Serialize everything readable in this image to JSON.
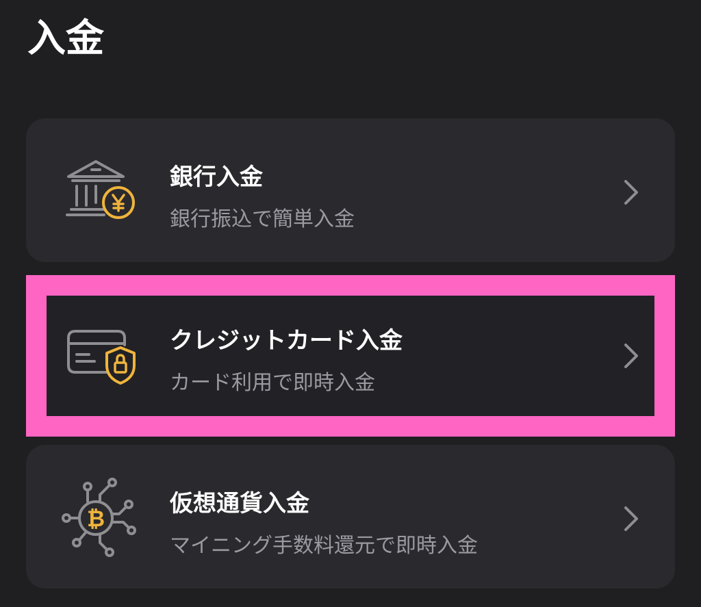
{
  "page": {
    "title": "入金"
  },
  "colors": {
    "background": "#1f1f22",
    "card": "#2a2a2e",
    "accent_gold": "#f0b43c",
    "highlight": "#ff66c4",
    "icon_gray": "#8e8e93"
  },
  "options": [
    {
      "title": "銀行入金",
      "subtitle": "銀行振込で簡単入金",
      "icon": "bank-yen-icon"
    },
    {
      "title": "クレジットカード入金",
      "subtitle": "カード利用で即時入金",
      "icon": "credit-card-lock-icon"
    },
    {
      "title": "仮想通貨入金",
      "subtitle": "マイニング手数料還元で即時入金",
      "icon": "bitcoin-network-icon"
    }
  ],
  "chevron_icon": "chevron-right-icon"
}
